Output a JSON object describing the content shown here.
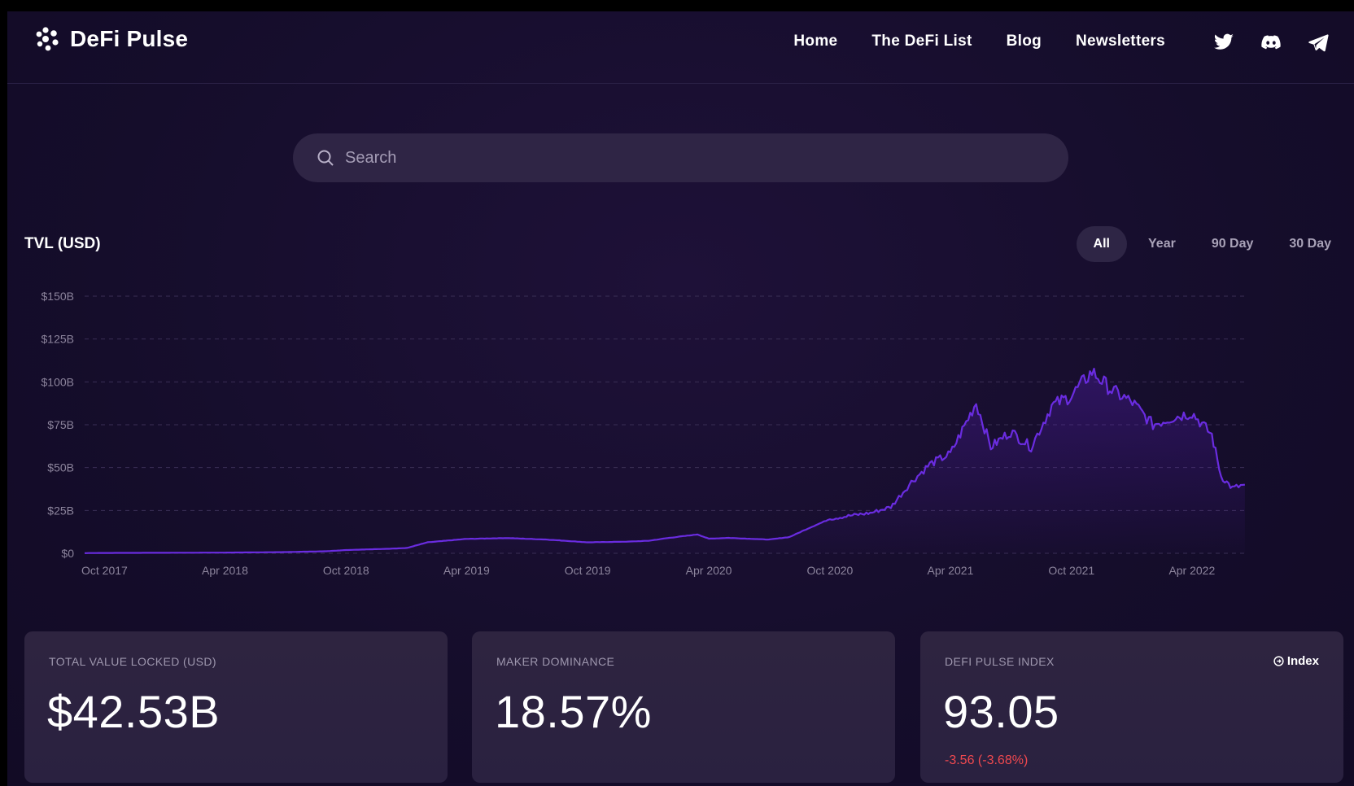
{
  "brand": {
    "name": "DeFi Pulse"
  },
  "nav": {
    "items": [
      {
        "label": "Home"
      },
      {
        "label": "The DeFi List"
      },
      {
        "label": "Blog"
      },
      {
        "label": "Newsletters"
      }
    ],
    "socials": [
      "twitter-icon",
      "discord-icon",
      "telegram-icon"
    ]
  },
  "search": {
    "placeholder": "Search"
  },
  "chart_header": {
    "title": "TVL (USD)",
    "ranges": [
      {
        "label": "All",
        "active": true
      },
      {
        "label": "Year",
        "active": false
      },
      {
        "label": "90 Day",
        "active": false
      },
      {
        "label": "30 Day",
        "active": false
      }
    ]
  },
  "chart_data": {
    "type": "area",
    "title": "TVL (USD)",
    "xlabel": "",
    "ylabel": "",
    "ylim": [
      0,
      150
    ],
    "y_unit": "B USD",
    "yticks": [
      "$0",
      "$25B",
      "$50B",
      "$75B",
      "$100B",
      "$125B",
      "$150B"
    ],
    "ytick_values": [
      0,
      25,
      50,
      75,
      100,
      125,
      150
    ],
    "xticks": [
      "Oct 2017",
      "Apr 2018",
      "Oct 2018",
      "Apr 2019",
      "Oct 2019",
      "Apr 2020",
      "Oct 2020",
      "Apr 2021",
      "Oct 2021",
      "Apr 2022"
    ],
    "grid": true,
    "line_color": "#6a2ce0",
    "series": [
      {
        "x": [
          "2017-09-01",
          "2017-10-01",
          "2018-01-01",
          "2018-04-01",
          "2018-07-01",
          "2018-09-01",
          "2018-10-01",
          "2018-12-01",
          "2019-01-01",
          "2019-02-01",
          "2019-04-01",
          "2019-06-01",
          "2019-08-01",
          "2019-10-01",
          "2019-12-01",
          "2020-01-01",
          "2020-02-01",
          "2020-03-15",
          "2020-04-01",
          "2020-05-01",
          "2020-06-01",
          "2020-07-01",
          "2020-08-01",
          "2020-09-01",
          "2020-10-01",
          "2020-11-01",
          "2020-12-01",
          "2021-01-01",
          "2021-02-01",
          "2021-03-01",
          "2021-04-01",
          "2021-05-10",
          "2021-06-01",
          "2021-07-01",
          "2021-08-01",
          "2021-09-01",
          "2021-10-01",
          "2021-11-01",
          "2021-12-01",
          "2022-01-01",
          "2022-02-01",
          "2022-03-01",
          "2022-04-01",
          "2022-05-01",
          "2022-05-15",
          "2022-06-01",
          "2022-06-20"
        ],
        "y": [
          0.1,
          0.2,
          0.3,
          0.4,
          0.7,
          1.2,
          1.9,
          2.6,
          3.1,
          6.4,
          8.4,
          8.9,
          8.0,
          6.4,
          6.8,
          7.3,
          9.0,
          11.0,
          8.5,
          9.0,
          8.5,
          8.0,
          9.5,
          15.0,
          20.0,
          22.0,
          23.5,
          27.0,
          41.5,
          52.0,
          58.0,
          88.0,
          62.0,
          71.0,
          62.0,
          86.0,
          92.0,
          106.0,
          95.0,
          88.0,
          75.0,
          79.0,
          82.0,
          69.0,
          45.0,
          38.0,
          40.0
        ]
      }
    ]
  },
  "stats": [
    {
      "label": "TOTAL VALUE LOCKED (USD)",
      "value": "$42.53B"
    },
    {
      "label": "MAKER DOMINANCE",
      "value": "18.57%"
    },
    {
      "label": "DEFI PULSE INDEX",
      "value": "93.05",
      "change": "-3.56  (-3.68%)",
      "link": "Index"
    }
  ]
}
